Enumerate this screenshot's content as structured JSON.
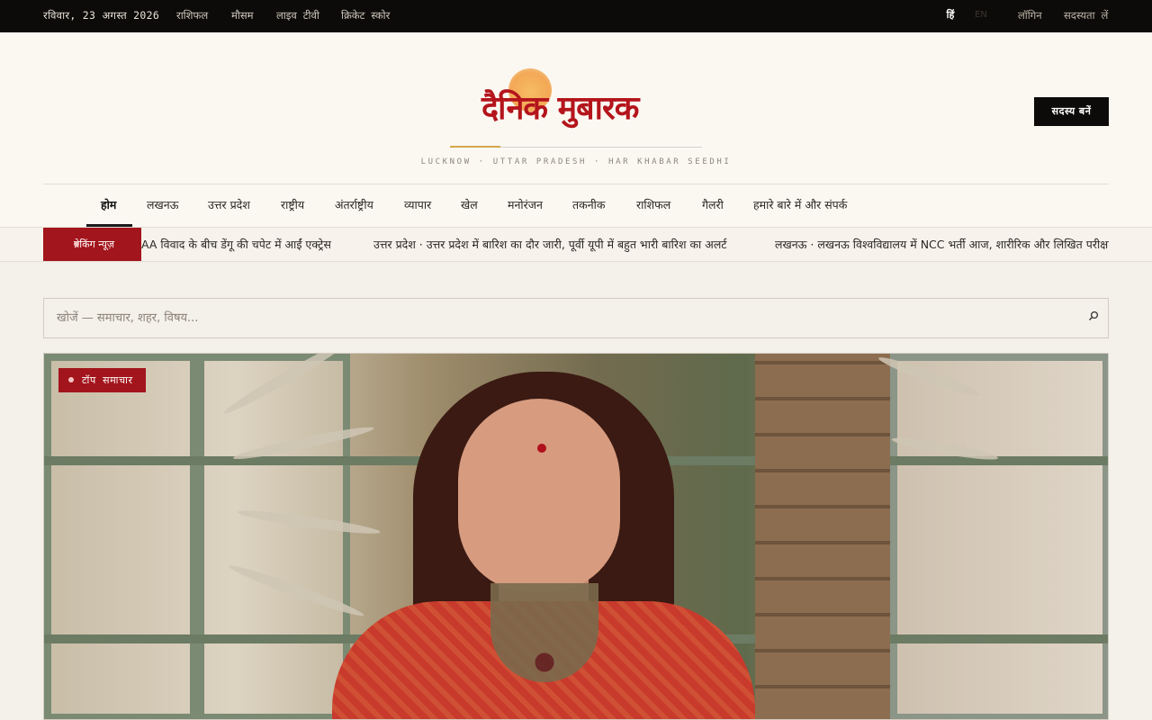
{
  "topbar": {
    "date": "रविवार, 23 अगस्त 2026",
    "links": [
      "राशिफल",
      "मौसम",
      "लाइव टीवी",
      "क्रिकेट स्कोर"
    ],
    "lang_hi": "हिं",
    "lang_en": "EN",
    "login": "लॉगिन",
    "subscribe": "सदस्यता लें"
  },
  "masthead": {
    "logo": "दैनिक मुबारक",
    "tagline": "LUCKNOW · UTTAR PRADESH · HAR KHABAR SEEDHI",
    "member_button": "सदस्य बनें"
  },
  "nav": {
    "items": [
      "होम",
      "लखनऊ",
      "उत्तर प्रदेश",
      "राष्ट्रीय",
      "अंतर्राष्ट्रीय",
      "व्यापार",
      "खेल",
      "मनोरंजन",
      "तकनीक",
      "राशिफल",
      "गैलरी",
      "हमारे बारे में और संपर्क"
    ],
    "active_index": 0
  },
  "ticker": {
    "label": "ब्रेकिंग न्यूज़",
    "items": [
      "AA विवाद के बीच डेंगू की चपेट में आईं एक्ट्रेस",
      "उत्तर प्रदेश · उत्तर प्रदेश में बारिश का दौर जारी, पूर्वी यूपी में बहुत भारी बारिश का अलर्ट",
      "लखनऊ · लखनऊ विश्वविद्यालय में NCC भर्ती आज, शारीरिक और लिखित परीक्षा"
    ]
  },
  "search": {
    "placeholder": "खोजें — समाचार, शहर, विषय..."
  },
  "hero": {
    "badge": "टॉप समाचार"
  },
  "colors": {
    "brand_red": "#a3151c",
    "topbar_bg": "#0d0b09",
    "page_bg": "#f4f0ea"
  }
}
